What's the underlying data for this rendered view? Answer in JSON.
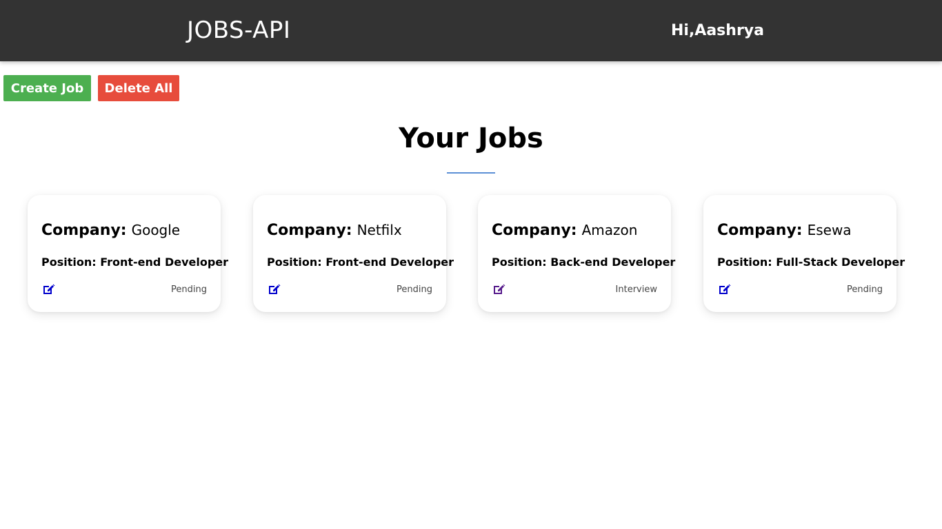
{
  "navbar": {
    "brand": "JOBS-API",
    "greeting": "Hi,Aashrya"
  },
  "actions": {
    "create_label": "Create Job",
    "delete_label": "Delete All"
  },
  "main": {
    "title": "Your Jobs"
  },
  "jobs": [
    {
      "company_label": "Company:",
      "company": "Google",
      "position": "Position: Front-end Developer",
      "status": "Pending",
      "icon": "edit-icon",
      "icon_color": "#0000cc"
    },
    {
      "company_label": "Company:",
      "company": "Netfilx",
      "position": "Position: Front-end Developer",
      "status": "Pending",
      "icon": "edit-icon",
      "icon_color": "#0000cc"
    },
    {
      "company_label": "Company:",
      "company": "Amazon",
      "position": "Position: Back-end Developer",
      "status": "Interview",
      "icon": "edit-icon",
      "icon_color": "#551a8b"
    },
    {
      "company_label": "Company:",
      "company": "Esewa",
      "position": "Position: Full-Stack Developer",
      "status": "Pending",
      "icon": "edit-icon",
      "icon_color": "#0000cc"
    }
  ],
  "colors": {
    "navbar_bg": "#333333",
    "create_button": "#4caf50",
    "delete_button": "#e74c3c",
    "underline": "#5b8fd6"
  }
}
